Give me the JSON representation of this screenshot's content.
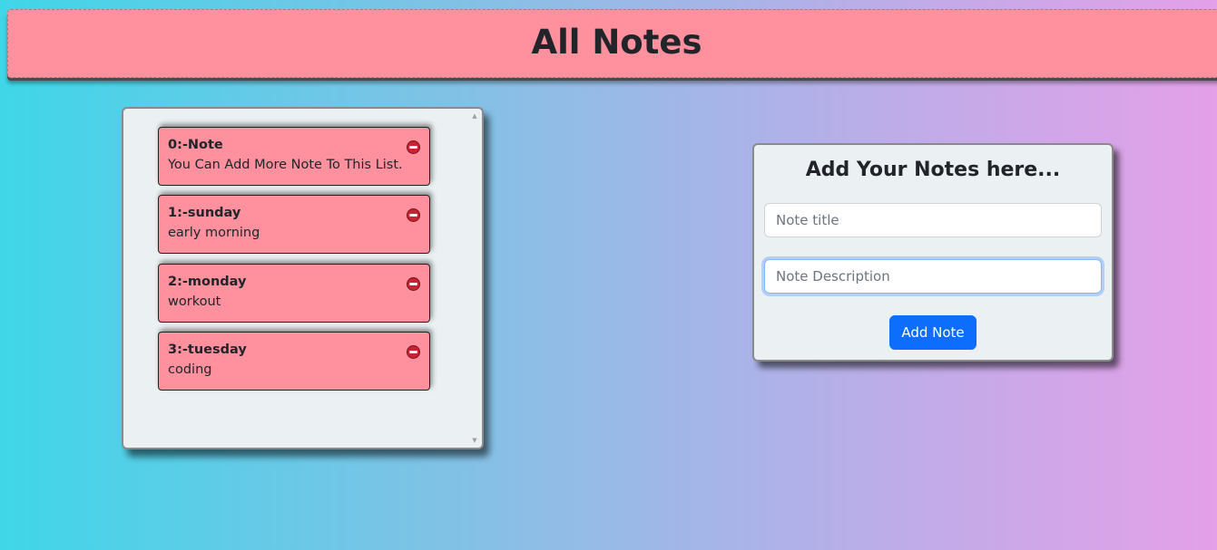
{
  "header": {
    "title": "All Notes"
  },
  "notes": [
    {
      "title": "0:-Note",
      "description": "You Can Add More Note To This List."
    },
    {
      "title": "1:-sunday",
      "description": "early morning"
    },
    {
      "title": "2:-monday",
      "description": "workout"
    },
    {
      "title": "3:-tuesday",
      "description": "coding"
    }
  ],
  "form": {
    "heading": "Add Your Notes here...",
    "title_placeholder": "Note title",
    "title_value": "",
    "description_placeholder": "Note Description",
    "description_value": "",
    "submit_label": "Add Note"
  },
  "icons": {
    "remove": "remove-circle-icon",
    "scroll_up": "scroll-up-arrow-icon",
    "scroll_down": "scroll-down-arrow-icon"
  },
  "colors": {
    "card_background": "#ff909e",
    "panel_background": "#ebf1f2",
    "primary_button": "#0d6efd",
    "remove_icon": "#c82333"
  }
}
